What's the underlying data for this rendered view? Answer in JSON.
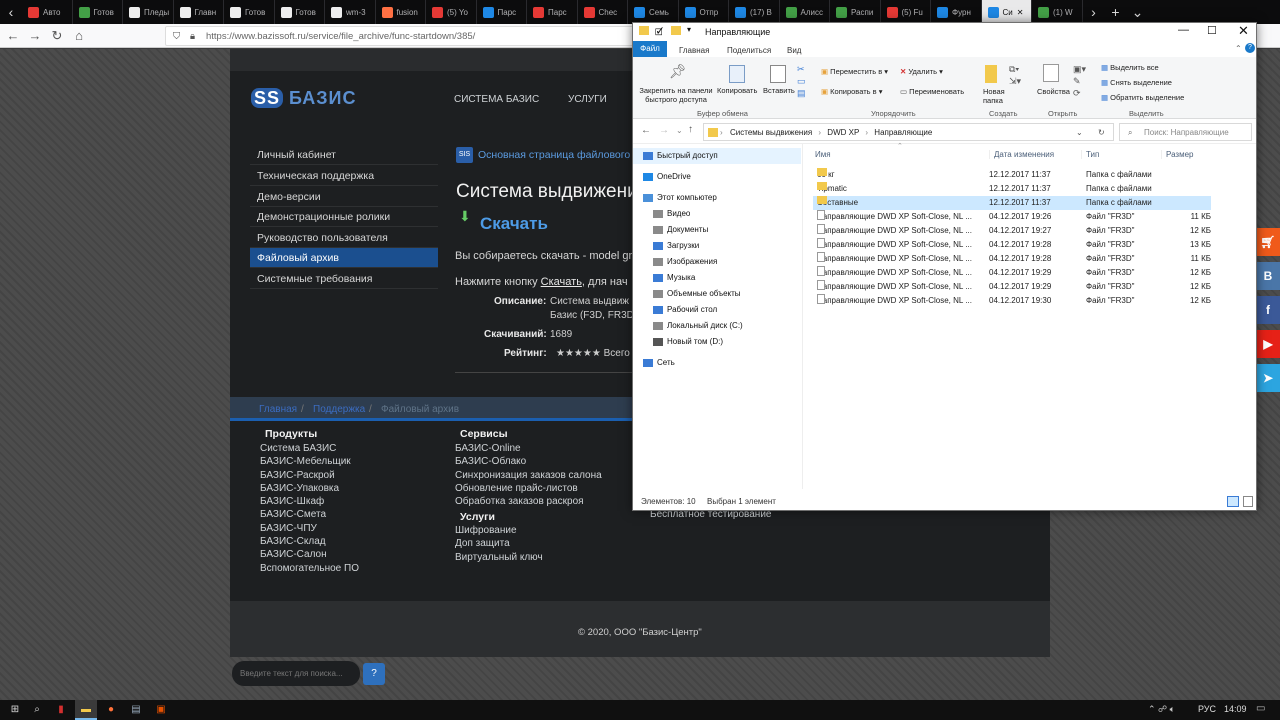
{
  "browser": {
    "tabs": [
      "Авто",
      "Готов",
      "Пледы",
      "Главн",
      "Готов",
      "Готов",
      "wm-3",
      "fusion",
      "(5) Yo",
      "Парс",
      "Парс",
      "Chec",
      "Семь",
      "Отпр",
      "(17) В",
      "Алисс",
      "Распи",
      "(5) Fu",
      "Фурн",
      "Си",
      "(1) W"
    ],
    "url": "https://www.bazissoft.ru/service/file_archive/func-startdown/385/"
  },
  "site": {
    "logo": "БАЗИС",
    "topnav": [
      "СИСТЕМА БАЗИС",
      "УСЛУГИ"
    ],
    "sidebar": [
      "Личный кабинет",
      "Техническая поддержка",
      "Демо-версии",
      "Демонстрационные ролики",
      "Руководство пользователя",
      "Файловый архив",
      "Системные требования"
    ],
    "archive_link": "Основная страница файлового ар",
    "heading": "Система выдвижени",
    "download": "Скачать",
    "about_line": "Вы собираетесь скачать - model gra",
    "press_prefix": "Нажмите кнопку ",
    "press_link": "Скачать",
    "press_suffix": ", для нач",
    "desc_label": "Описание:",
    "desc_value1": "Система выдвиж",
    "desc_value2": "Базис (F3D, FR3D",
    "downloads_label": "Скачиваний:",
    "downloads_value": "1689",
    "rating_label": "Рейтинг:",
    "rating_stars": "★★★★★",
    "rating_suffix": " Всего го",
    "breadcrumb": [
      "Главная",
      "Поддержка",
      "Файловый архив"
    ],
    "footer": {
      "products_title": "Продукты",
      "products": [
        "Система БАЗИС",
        "БАЗИС-Мебельщик",
        "БАЗИС-Раскрой",
        "БАЗИС-Упаковка",
        "БАЗИС-Шкаф",
        "БАЗИС-Смета",
        "БАЗИС-ЧПУ",
        "БАЗИС-Склад",
        "БАЗИС-Салон",
        "Вспомогательное ПО"
      ],
      "services_title": "Сервисы",
      "services": [
        "БАЗИС-Online",
        "БАЗИС-Облако",
        "Синхронизация заказов салона",
        "Обновление прайс-листов",
        "Обработка заказов раскроя"
      ],
      "uslugi_title": "Услуги",
      "uslugi": [
        "Шифрование",
        "Доп защита",
        "Виртуальный ключ"
      ],
      "extra": "Бесплатное тестирование",
      "copyright": "© 2020, ООО \"Базис-Центр\""
    },
    "search_placeholder": "Введите текст для поиска...",
    "search_btn": "?"
  },
  "explorer": {
    "title": "Направляющие",
    "menu": [
      "Файл",
      "Главная",
      "Поделиться",
      "Вид"
    ],
    "ribbon": {
      "pin": "Закрепить на панели быстрого доступа",
      "copy": "Копировать",
      "paste": "Вставить",
      "move": "Переместить в",
      "copyto": "Копировать в",
      "delete": "Удалить",
      "rename": "Переименовать",
      "newfolder": "Новая папка",
      "props": "Свойства",
      "selall": "Выделить все",
      "selnone": "Снять выделение",
      "selinv": "Обратить выделение",
      "groups": [
        "Буфер обмена",
        "Упорядочить",
        "Создать",
        "Открыть",
        "Выделить"
      ]
    },
    "path": [
      "Системы выдвижения",
      "DWD XP",
      "Направляющие"
    ],
    "search_placeholder": "Поиск: Направляющие",
    "nav": [
      "Быстрый доступ",
      "OneDrive",
      "Этот компьютер",
      "Видео",
      "Документы",
      "Загрузки",
      "Изображения",
      "Музыка",
      "Объемные объекты",
      "Рабочий стол",
      "Локальный диск (C:)",
      "Новый том (D:)",
      "Сеть"
    ],
    "columns": [
      "Имя",
      "Дата изменения",
      "Тип",
      "Размер"
    ],
    "files": [
      {
        "name": "60 кг",
        "date": "12.12.2017 11:37",
        "type": "Папка с файлами",
        "size": "",
        "folder": true
      },
      {
        "name": "Tipmatic",
        "date": "12.12.2017 11:37",
        "type": "Папка с файлами",
        "size": "",
        "folder": true
      },
      {
        "name": "Составные",
        "date": "12.12.2017 11:37",
        "type": "Папка с файлами",
        "size": "",
        "folder": true
      },
      {
        "name": "Направляющие DWD XP Soft-Close, NL ...",
        "date": "04.12.2017 19:26",
        "type": "Файл \"FR3D\"",
        "size": "11 КБ"
      },
      {
        "name": "Направляющие DWD XP Soft-Close, NL ...",
        "date": "04.12.2017 19:27",
        "type": "Файл \"FR3D\"",
        "size": "12 КБ"
      },
      {
        "name": "Направляющие DWD XP Soft-Close, NL ...",
        "date": "04.12.2017 19:28",
        "type": "Файл \"FR3D\"",
        "size": "13 КБ"
      },
      {
        "name": "Направляющие DWD XP Soft-Close, NL ...",
        "date": "04.12.2017 19:28",
        "type": "Файл \"FR3D\"",
        "size": "11 КБ"
      },
      {
        "name": "Направляющие DWD XP Soft-Close, NL ...",
        "date": "04.12.2017 19:29",
        "type": "Файл \"FR3D\"",
        "size": "12 КБ"
      },
      {
        "name": "Направляющие DWD XP Soft-Close, NL ...",
        "date": "04.12.2017 19:29",
        "type": "Файл \"FR3D\"",
        "size": "12 КБ"
      },
      {
        "name": "Направляющие DWD XP Soft-Close, NL ...",
        "date": "04.12.2017 19:30",
        "type": "Файл \"FR3D\"",
        "size": "12 КБ"
      }
    ],
    "status_count": "Элементов: 10",
    "status_sel": "Выбран 1 элемент"
  },
  "taskbar": {
    "lang": "РУС",
    "time": "14:09"
  }
}
